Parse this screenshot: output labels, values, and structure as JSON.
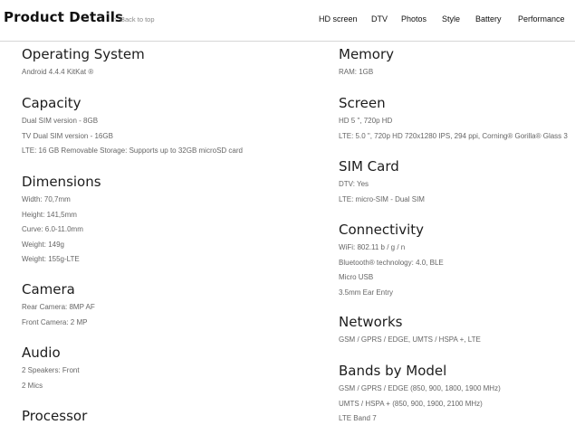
{
  "header": {
    "title": "Product Details",
    "back_to_top": "Back to top",
    "nav": [
      "HD screen",
      "DTV",
      "Photos",
      "Style",
      "Battery",
      "Performance"
    ]
  },
  "left": [
    {
      "heading": "Operating System",
      "items": [
        "Android 4.4.4 KitKat ®"
      ]
    },
    {
      "heading": "Capacity",
      "items": [
        "Dual SIM version - 8GB",
        "TV Dual SIM version - 16GB",
        "LTE: 16 GB Removable Storage: Supports up to 32GB microSD card"
      ]
    },
    {
      "heading": "Dimensions",
      "items": [
        "Width: 70,7mm",
        "Height: 141,5mm",
        "Curve: 6.0-11.0mm",
        "Weight: 149g",
        "Weight: 155g-LTE"
      ]
    },
    {
      "heading": "Camera",
      "items": [
        "Rear Camera: 8MP AF",
        "Front Camera: 2 MP"
      ]
    },
    {
      "heading": "Audio",
      "items": [
        "2 Speakers: Front",
        "2 Mics"
      ]
    },
    {
      "heading": "Processor",
      "items": []
    }
  ],
  "right": [
    {
      "heading": "Memory",
      "items": [
        "RAM: 1GB"
      ]
    },
    {
      "heading": "Screen",
      "items": [
        "HD 5 \", 720p HD",
        "LTE: 5.0 \", 720p HD 720x1280 IPS, 294 ppi, Corning® Gorilla® Glass 3"
      ]
    },
    {
      "heading": "SIM Card",
      "items": [
        "DTV: Yes",
        "LTE: micro-SIM - Dual SIM"
      ]
    },
    {
      "heading": "Connectivity",
      "items": [
        "WiFi: 802.11 b / g / n",
        "Bluetooth® technology: 4.0, BLE",
        "Micro USB",
        "3.5mm Ear Entry"
      ]
    },
    {
      "heading": "Networks",
      "items": [
        "GSM / GPRS / EDGE, UMTS / HSPA +, LTE"
      ]
    },
    {
      "heading": "Bands by Model",
      "items": [
        "GSM / GPRS / EDGE (850, 900, 1800, 1900 MHz)",
        "UMTS / HSPA + (850, 900, 1900, 2100 MHz)",
        "LTE Band 7"
      ]
    }
  ]
}
